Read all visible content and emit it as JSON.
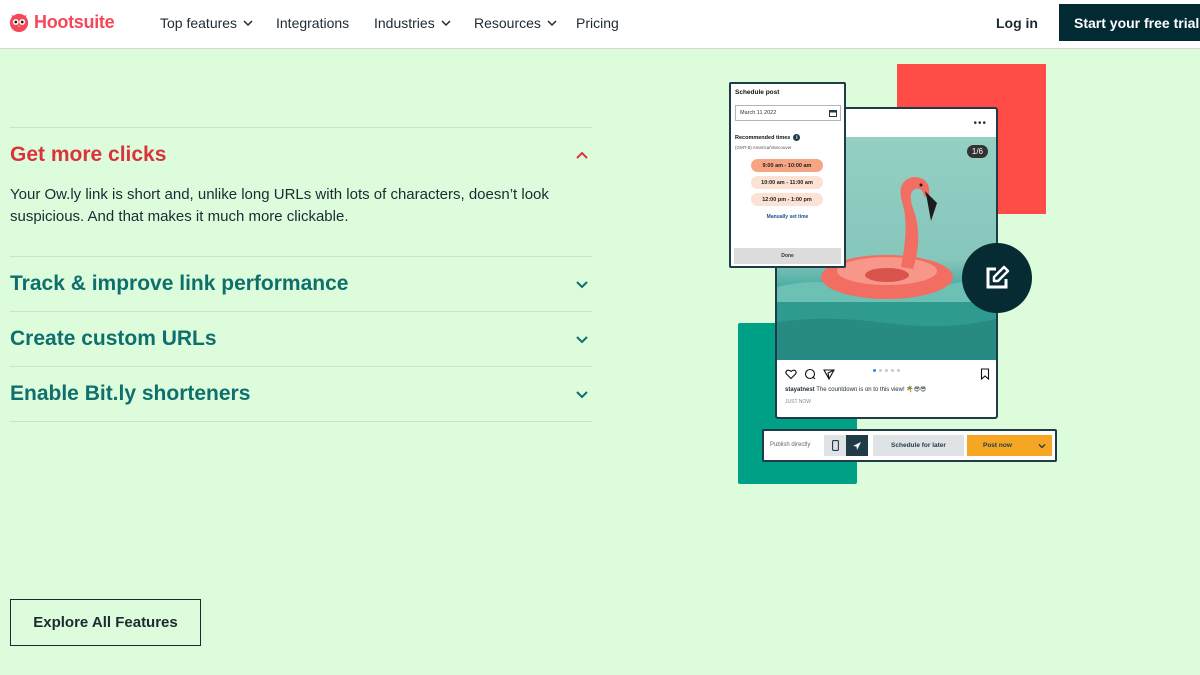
{
  "nav": {
    "logo_text": "Hootsuite",
    "items": [
      {
        "label": "Top features",
        "has_dropdown": true
      },
      {
        "label": "Integrations",
        "has_dropdown": false
      },
      {
        "label": "Industries",
        "has_dropdown": true
      },
      {
        "label": "Resources",
        "has_dropdown": true
      },
      {
        "label": "Pricing",
        "has_dropdown": false
      }
    ],
    "login": "Log in",
    "cta": "Start your free trial"
  },
  "accordion": [
    {
      "title": "Get more clicks",
      "expanded": true,
      "body": "Your Ow.ly link is short and, unlike long URLs with lots of characters, doesn’t look suspicious. And that makes it much more clickable."
    },
    {
      "title": "Track & improve link performance",
      "expanded": false
    },
    {
      "title": "Create custom URLs",
      "expanded": false
    },
    {
      "title": "Enable Bit.ly shorteners",
      "expanded": false
    }
  ],
  "explore_button": "Explore All Features",
  "illustration": {
    "schedule_title": "Schedule post",
    "date_value": "March 11 2022",
    "recommended_label": "Recommended times",
    "timezone": "(GMT-8) America/Vancouver",
    "slots": [
      "9:00 am - 10:00 am",
      "10:00 am - 11:00 am",
      "12:00 pm - 1:00 pm"
    ],
    "manual": "Manually set time",
    "done": "Done",
    "photo_counter": "1/6",
    "username": "stayatnest",
    "caption": "The countdown is on to this view! 🌴😎😎",
    "time_ago": "JUST NOW",
    "publish_label": "Publish directly",
    "schedule_later": "Schedule for later",
    "post_now": "Post now"
  },
  "colors": {
    "page_bg": "#dcfcdc",
    "brand_red": "#f4485b",
    "active_title": "#d9343b",
    "teal_title": "#0f6f6c",
    "cta_bg": "#012a33",
    "post_now_bg": "#f5a623"
  }
}
